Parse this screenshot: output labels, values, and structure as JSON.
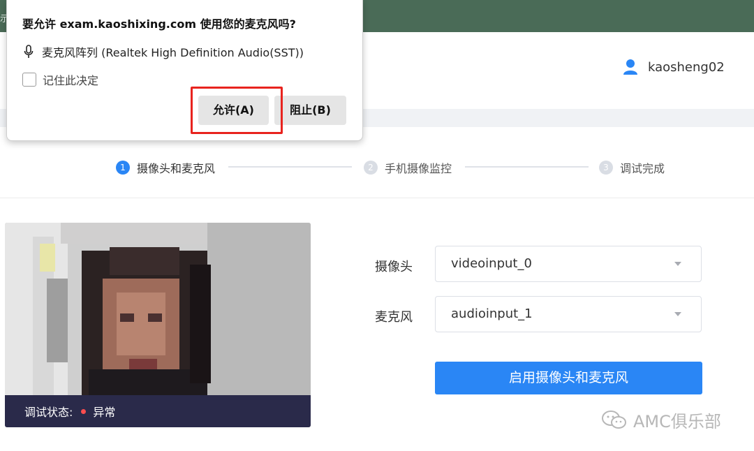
{
  "topbar": {
    "stub_text": "示"
  },
  "header": {
    "username": "kaosheng02",
    "user_icon": "user-icon"
  },
  "steps": [
    {
      "number": "1",
      "label": "摄像头和麦克风",
      "state": "active"
    },
    {
      "number": "2",
      "label": "手机摄像监控",
      "state": "inactive"
    },
    {
      "number": "3",
      "label": "调试完成",
      "state": "inactive"
    }
  ],
  "video": {
    "status_label": "调试状态:",
    "status_value": "异常",
    "status_color": "#ff4d4f"
  },
  "form": {
    "camera_label": "摄像头",
    "camera_value": "videoinput_0",
    "mic_label": "麦克风",
    "mic_value": "audioinput_1",
    "enable_button": "启用摄像头和麦克风"
  },
  "permission_dialog": {
    "title": "要允许 exam.kaoshixing.com 使用您的麦克风吗?",
    "device": "麦克风阵列 (Realtek High Definition Audio(SST))",
    "remember_label": "记住此决定",
    "allow_button": "允许(A)",
    "block_button": "阻止(B)"
  },
  "watermark": {
    "text": "AMC俱乐部",
    "icon": "wechat-icon"
  },
  "colors": {
    "accent": "#2a86f5",
    "topbar": "#4a6b57",
    "highlight": "#e8231e"
  }
}
